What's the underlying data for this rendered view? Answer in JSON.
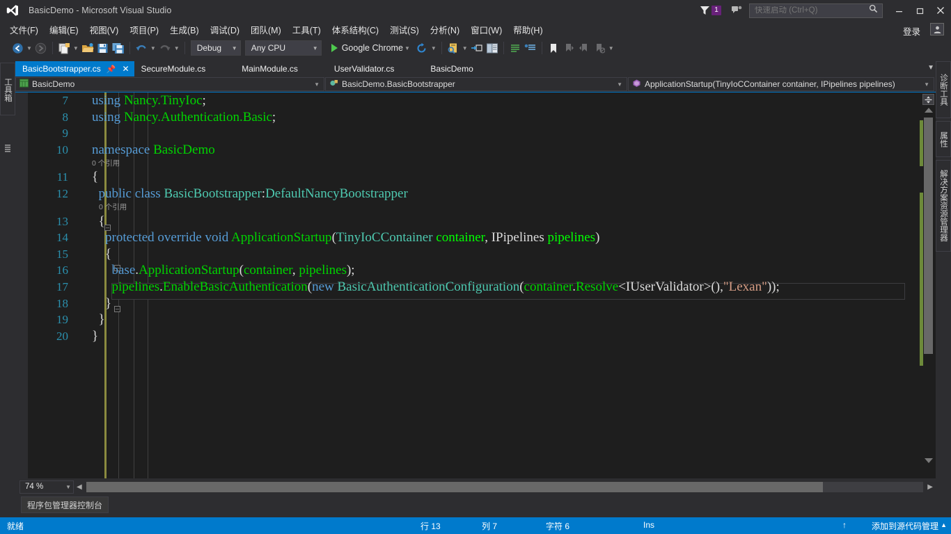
{
  "window": {
    "title": "BasicDemo - Microsoft Visual Studio",
    "logo_icon": "visual-studio-logo",
    "minimize_label": "–",
    "maximize_label": "❐",
    "close_label": "✕",
    "notification_count": "1",
    "flag_icon": "notifications-flag-icon",
    "feedback_icon": "send-feedback-icon",
    "signin_label": "登录",
    "account_icon": "user-account-icon"
  },
  "quick_launch": {
    "placeholder": "快速启动 (Ctrl+Q)",
    "value": "",
    "search_icon": "search-magnifier-icon"
  },
  "menubar": {
    "items": [
      {
        "label": "文件(F)"
      },
      {
        "label": "编辑(E)"
      },
      {
        "label": "视图(V)"
      },
      {
        "label": "项目(P)"
      },
      {
        "label": "生成(B)"
      },
      {
        "label": "调试(D)"
      },
      {
        "label": "团队(M)"
      },
      {
        "label": "工具(T)"
      },
      {
        "label": "体系结构(C)"
      },
      {
        "label": "测试(S)"
      },
      {
        "label": "分析(N)"
      },
      {
        "label": "窗口(W)"
      },
      {
        "label": "帮助(H)"
      }
    ]
  },
  "toolbar": {
    "nav_back_icon": "navigate-back-icon",
    "nav_forward_icon": "navigate-forward-icon",
    "new_project_icon": "new-project-icon",
    "open_file_icon": "open-file-icon",
    "save_icon": "save-icon",
    "save_all_icon": "save-all-icon",
    "undo_icon": "undo-icon",
    "redo_icon": "redo-icon",
    "configuration": "Debug",
    "platform": "Any CPU",
    "run_target": "Google Chrome",
    "refresh_icon": "browser-refresh-icon",
    "find_icon": "find-in-files-icon",
    "step_icon": "step-into-icon",
    "window_icon": "new-window-icon",
    "comment_icon": "comment-selection-icon",
    "uncomment_icon": "uncomment-selection-icon",
    "bookmark_icon": "bookmark-icon",
    "bookmark_prev_icon": "previous-bookmark-icon",
    "bookmark_next_icon": "next-bookmark-icon",
    "bookmark_clear_icon": "clear-bookmarks-icon",
    "overflow_icon": "toolbar-overflow-icon"
  },
  "left_dock": {
    "toolbox_label": "工具箱"
  },
  "right_dock": {
    "items": [
      {
        "label": "诊断工具"
      },
      {
        "label": "属性"
      },
      {
        "label": "解决方案资源管理器"
      }
    ]
  },
  "tabs": [
    {
      "label": "BasicBootstrapper.cs",
      "active": true,
      "pin_icon": "pin-icon",
      "close_icon": "close-icon"
    },
    {
      "label": "SecureModule.cs",
      "active": false
    },
    {
      "label": "MainModule.cs",
      "active": false
    },
    {
      "label": "UserValidator.cs",
      "active": false
    },
    {
      "label": "BasicDemo",
      "active": false
    }
  ],
  "tab_overflow_icon": "tab-list-dropdown-icon",
  "navbar": {
    "project": "BasicDemo",
    "project_icon": "csharp-project-icon",
    "type": "BasicDemo.BasicBootstrapper",
    "type_icon": "class-icon",
    "member": "ApplicationStartup(TinyIoCContainer container, IPipelines pipelines)",
    "member_icon": "method-icon"
  },
  "editor": {
    "codelens_label": "0 个引用",
    "lines": [
      {
        "num": "7",
        "tokens": [
          {
            "t": "using ",
            "c": "kw"
          },
          {
            "t": "Nancy.TinyIoc",
            "c": "id"
          },
          {
            "t": ";",
            "c": "pun"
          }
        ]
      },
      {
        "num": "8",
        "tokens": [
          {
            "t": "using ",
            "c": "kw"
          },
          {
            "t": "Nancy.Authentication.Basic",
            "c": "id"
          },
          {
            "t": ";",
            "c": "pun"
          }
        ]
      },
      {
        "num": "9",
        "tokens": []
      },
      {
        "num": "10",
        "tokens": [
          {
            "t": "namespace ",
            "c": "kw"
          },
          {
            "t": "BasicDemo",
            "c": "id"
          }
        ]
      },
      {
        "num": "11",
        "tokens": [
          {
            "t": "{",
            "c": "pun"
          }
        ]
      },
      {
        "num": "12",
        "tokens": [
          {
            "t": "  ",
            "c": "pln"
          },
          {
            "t": "public class ",
            "c": "kw"
          },
          {
            "t": "BasicBootstrapper",
            "c": "typ"
          },
          {
            "t": ":",
            "c": "pun"
          },
          {
            "t": "DefaultNancyBootstrapper",
            "c": "typ"
          }
        ]
      },
      {
        "num": "13",
        "tokens": [
          {
            "t": "  {",
            "c": "pun"
          }
        ]
      },
      {
        "num": "14",
        "tokens": [
          {
            "t": "    ",
            "c": "pln"
          },
          {
            "t": "protected override void ",
            "c": "kw"
          },
          {
            "t": "ApplicationStartup",
            "c": "id"
          },
          {
            "t": "(",
            "c": "pun"
          },
          {
            "t": "TinyIoCContainer ",
            "c": "typ"
          },
          {
            "t": "container",
            "c": "par"
          },
          {
            "t": ", ",
            "c": "pun"
          },
          {
            "t": "IPipelines ",
            "c": "pln"
          },
          {
            "t": "pipelines",
            "c": "par"
          },
          {
            "t": ")",
            "c": "pun"
          }
        ]
      },
      {
        "num": "15",
        "tokens": [
          {
            "t": "    {",
            "c": "pun"
          }
        ]
      },
      {
        "num": "16",
        "tokens": [
          {
            "t": "      ",
            "c": "pln"
          },
          {
            "t": "base",
            "c": "kw"
          },
          {
            "t": ".",
            "c": "pun"
          },
          {
            "t": "ApplicationStartup",
            "c": "id"
          },
          {
            "t": "(",
            "c": "pun"
          },
          {
            "t": "container",
            "c": "id"
          },
          {
            "t": ", ",
            "c": "pun"
          },
          {
            "t": "pipelines",
            "c": "id"
          },
          {
            "t": ");",
            "c": "pun"
          }
        ]
      },
      {
        "num": "17",
        "tokens": [
          {
            "t": "      ",
            "c": "pln"
          },
          {
            "t": "pipelines",
            "c": "id"
          },
          {
            "t": ".",
            "c": "pun"
          },
          {
            "t": "EnableBasicAuthentication",
            "c": "id"
          },
          {
            "t": "(",
            "c": "pun"
          },
          {
            "t": "new ",
            "c": "kw"
          },
          {
            "t": "BasicAuthenticationConfiguration",
            "c": "typ"
          },
          {
            "t": "(",
            "c": "pun"
          },
          {
            "t": "container",
            "c": "id"
          },
          {
            "t": ".",
            "c": "pun"
          },
          {
            "t": "Resolve",
            "c": "id"
          },
          {
            "t": "<IUserValidator>(),",
            "c": "pun"
          },
          {
            "t": "\"Lexan\"",
            "c": "str"
          },
          {
            "t": "));",
            "c": "pun"
          }
        ]
      },
      {
        "num": "18",
        "tokens": [
          {
            "t": "    }",
            "c": "pun"
          }
        ]
      },
      {
        "num": "19",
        "tokens": [
          {
            "t": "  }",
            "c": "pun"
          }
        ]
      },
      {
        "num": "20",
        "tokens": [
          {
            "t": "}",
            "c": "pun"
          }
        ]
      }
    ]
  },
  "zoom": {
    "level": "74 %",
    "dropdown_icon": "chevron-down-icon"
  },
  "bottom_panel": {
    "pmc_label": "程序包管理器控制台"
  },
  "statusbar": {
    "ready": "就绪",
    "line": "行 13",
    "column": "列 7",
    "character": "字符 6",
    "insert_mode": "Ins",
    "source_control": "添加到源代码管理",
    "source_control_icon": "upload-arrow-icon",
    "source_control_caret": "▲"
  }
}
